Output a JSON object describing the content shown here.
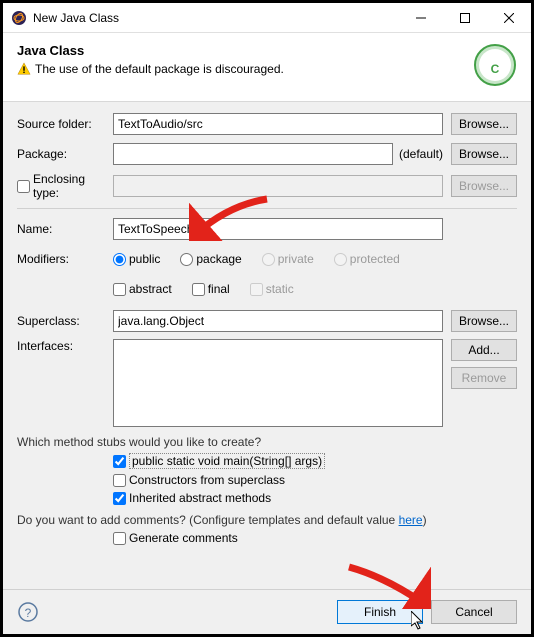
{
  "window": {
    "title": "New Java Class"
  },
  "banner": {
    "heading": "Java Class",
    "warning": "The use of the default package is discouraged."
  },
  "labels": {
    "source_folder": "Source folder:",
    "package": "Package:",
    "enclosing_type": "Enclosing type:",
    "name": "Name:",
    "modifiers": "Modifiers:",
    "superclass": "Superclass:",
    "interfaces": "Interfaces:",
    "default": "(default)"
  },
  "values": {
    "source_folder": "TextToAudio/src",
    "package": "",
    "enclosing_type": "",
    "name": "TextToSpeech",
    "superclass": "java.lang.Object"
  },
  "buttons": {
    "browse": "Browse...",
    "add": "Add...",
    "remove": "Remove",
    "finish": "Finish",
    "cancel": "Cancel"
  },
  "modifiers": {
    "public": "public",
    "package": "package",
    "private": "private",
    "protected": "protected",
    "abstract": "abstract",
    "final": "final",
    "static": "static"
  },
  "stubs": {
    "question": "Which method stubs would you like to create?",
    "main": "public static void main(String[] args)",
    "constructors": "Constructors from superclass",
    "inherited": "Inherited abstract methods"
  },
  "comments": {
    "question_pre": "Do you want to add comments? (Configure templates and default value ",
    "here": "here",
    "question_post": ")",
    "generate": "Generate comments"
  }
}
